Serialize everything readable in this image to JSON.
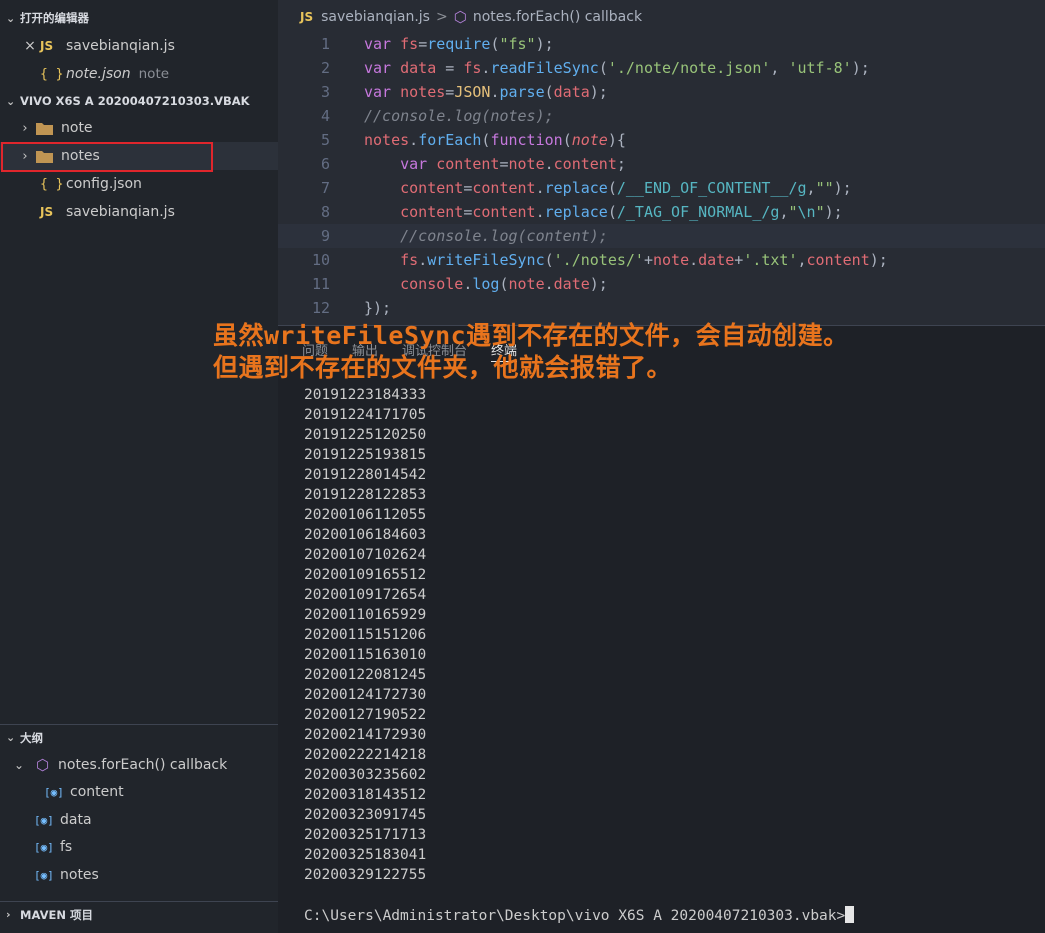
{
  "sidebar": {
    "open_editors": {
      "header": "打开的编辑器",
      "items": [
        {
          "icon": "JS",
          "name": "savebianqian.js",
          "close": "×"
        },
        {
          "icon": "{ }",
          "name": "note.json",
          "detail": "note"
        }
      ]
    },
    "project": {
      "header": "VIVO X6S A 20200407210303.VBAK",
      "items": [
        {
          "name": "note",
          "type": "folder"
        },
        {
          "name": "notes",
          "type": "folder"
        },
        {
          "icon": "{ }",
          "name": "config.json"
        },
        {
          "icon": "JS",
          "name": "savebianqian.js"
        }
      ]
    },
    "outline": {
      "header": "大纲",
      "items": [
        {
          "name": "notes.forEach() callback"
        },
        {
          "name": "content"
        },
        {
          "name": "data"
        },
        {
          "name": "fs"
        },
        {
          "name": "notes"
        }
      ]
    },
    "maven": {
      "header": "MAVEN 项目"
    }
  },
  "editor": {
    "breadcrumb": {
      "file_icon": "JS",
      "file": "savebianqian.js",
      "separator": ">",
      "symbol": "notes.forEach() callback"
    },
    "line_numbers": [
      "1",
      "2",
      "3",
      "4",
      "5",
      "6",
      "7",
      "8",
      "9",
      "10",
      "11",
      "12"
    ]
  },
  "panel": {
    "tabs": [
      "问题",
      "输出",
      "调试控制台",
      "终端"
    ],
    "output_lines": [
      "20191223184333",
      "20191224171705",
      "20191225120250",
      "20191225193815",
      "20191228014542",
      "20191228122853",
      "20200106112055",
      "20200106184603",
      "20200107102624",
      "20200109165512",
      "20200109172654",
      "20200110165929",
      "20200115151206",
      "20200115163010",
      "20200122081245",
      "20200124172730",
      "20200127190522",
      "20200214172930",
      "20200222214218",
      "20200303235602",
      "20200318143512",
      "20200323091745",
      "20200325171713",
      "20200325183041",
      "20200329122755"
    ],
    "prompt": "C:\\Users\\Administrator\\Desktop\\vivo X6S A 20200407210303.vbak>"
  },
  "annotation": {
    "line1": "虽然writeFileSync遇到不存在的文件，会自动创建。",
    "line2": "但遇到不存在的文件夹，他就会报错了。"
  },
  "colors": {
    "annotation": "#e8741d",
    "highlight_box": "#e0262c",
    "js_icon": "#e8c45b",
    "symbol_icon": "#75beff"
  }
}
